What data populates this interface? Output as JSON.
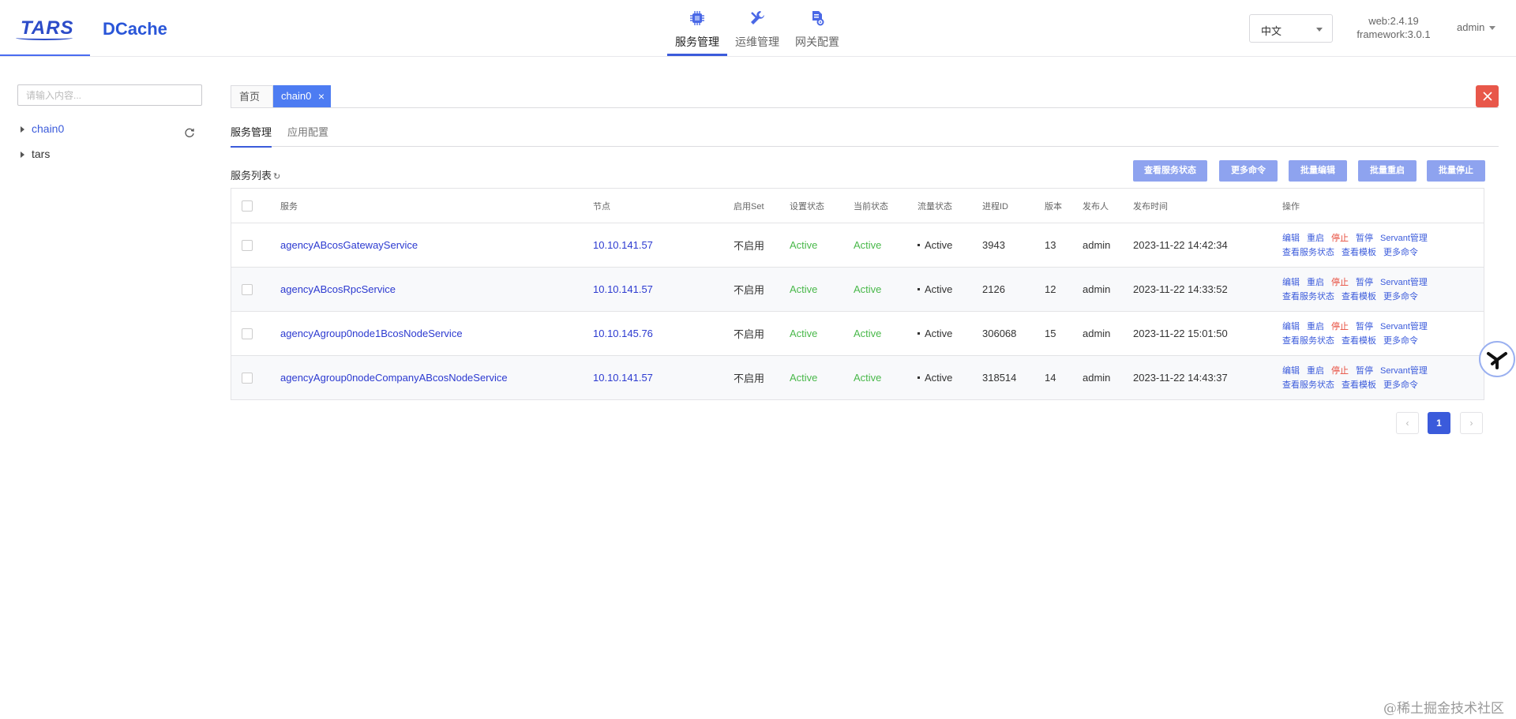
{
  "header": {
    "logo_tars": "TARS",
    "logo_dcache": "DCache",
    "nav": [
      {
        "label": "服务管理",
        "icon": "chip-icon",
        "active": true
      },
      {
        "label": "运维管理",
        "icon": "wrench-icon",
        "active": false
      },
      {
        "label": "网关配置",
        "icon": "gateway-config-icon",
        "active": false
      }
    ],
    "language": "中文",
    "version_web": "web:2.4.19",
    "version_framework": "framework:3.0.1",
    "user": "admin"
  },
  "sidebar": {
    "search_placeholder": "请输入内容...",
    "tree": [
      {
        "label": "chain0",
        "active": true
      },
      {
        "label": "tars",
        "active": false
      }
    ]
  },
  "page_tabs": {
    "home": "首页",
    "current": "chain0",
    "close_symbol": "×"
  },
  "sub_tabs": [
    "服务管理",
    "应用配置"
  ],
  "list": {
    "title": "服务列表",
    "refresh_glyph": "↻",
    "actions": [
      "查看服务状态",
      "更多命令",
      "批量编辑",
      "批量重启",
      "批量停止"
    ],
    "columns": [
      "服务",
      "节点",
      "启用Set",
      "设置状态",
      "当前状态",
      "流量状态",
      "进程ID",
      "版本",
      "发布人",
      "发布时间",
      "操作"
    ],
    "rows": [
      {
        "service": "agencyABcosGatewayService",
        "node": "10.10.141.57",
        "set": "不启用",
        "setting_state": "Active",
        "current_state": "Active",
        "flow_state": "Active",
        "pid": "3943",
        "version": "13",
        "publisher": "admin",
        "publish_time": "2023-11-22 14:42:34"
      },
      {
        "service": "agencyABcosRpcService",
        "node": "10.10.141.57",
        "set": "不启用",
        "setting_state": "Active",
        "current_state": "Active",
        "flow_state": "Active",
        "pid": "2126",
        "version": "12",
        "publisher": "admin",
        "publish_time": "2023-11-22 14:33:52"
      },
      {
        "service": "agencyAgroup0node1BcosNodeService",
        "node": "10.10.145.76",
        "set": "不启用",
        "setting_state": "Active",
        "current_state": "Active",
        "flow_state": "Active",
        "pid": "306068",
        "version": "15",
        "publisher": "admin",
        "publish_time": "2023-11-22 15:01:50"
      },
      {
        "service": "agencyAgroup0nodeCompanyABcosNodeService",
        "node": "10.10.141.57",
        "set": "不启用",
        "setting_state": "Active",
        "current_state": "Active",
        "flow_state": "Active",
        "pid": "318514",
        "version": "14",
        "publisher": "admin",
        "publish_time": "2023-11-22 14:43:37"
      }
    ],
    "row_ops": {
      "line1": [
        "编辑",
        "重启",
        "停止",
        "暂停",
        "Servant管理"
      ],
      "line2": [
        "查看服务状态",
        "查看模板",
        "更多命令"
      ]
    }
  },
  "pagination": {
    "prev": "‹",
    "current": "1",
    "next": "›"
  },
  "watermark": "@稀土掘金技术社区",
  "colors": {
    "accent": "#3b5bdb",
    "active_green": "#49b84a",
    "danger": "#e8574a",
    "button": "#8ea3ef"
  }
}
